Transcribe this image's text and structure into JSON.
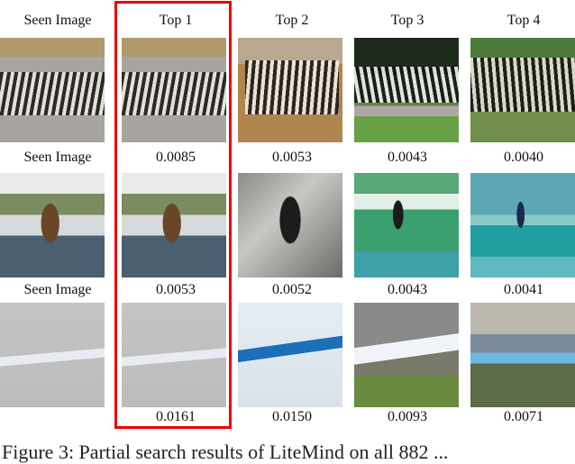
{
  "figure": {
    "column_headers": [
      "Seen Image",
      "Top 1",
      "Top 2",
      "Top 3",
      "Top 4"
    ],
    "highlight_color": "#ee0000",
    "highlighted_column": "Top 1",
    "rows": [
      {
        "query_label": "Seen Image",
        "subject": "zebras",
        "scores": [
          "0.0085",
          "0.0053",
          "0.0043",
          "0.0040"
        ]
      },
      {
        "query_label": "Seen Image",
        "subject": "surfer",
        "scores": [
          "0.0053",
          "0.0052",
          "0.0043",
          "0.0041"
        ]
      },
      {
        "query_label": "Seen Image",
        "subject": "airplane",
        "scores": [
          "0.0161",
          "0.0150",
          "0.0093",
          "0.0071"
        ]
      }
    ],
    "caption": "Figure 3: Partial search results of LiteMind on all 882 ..."
  }
}
